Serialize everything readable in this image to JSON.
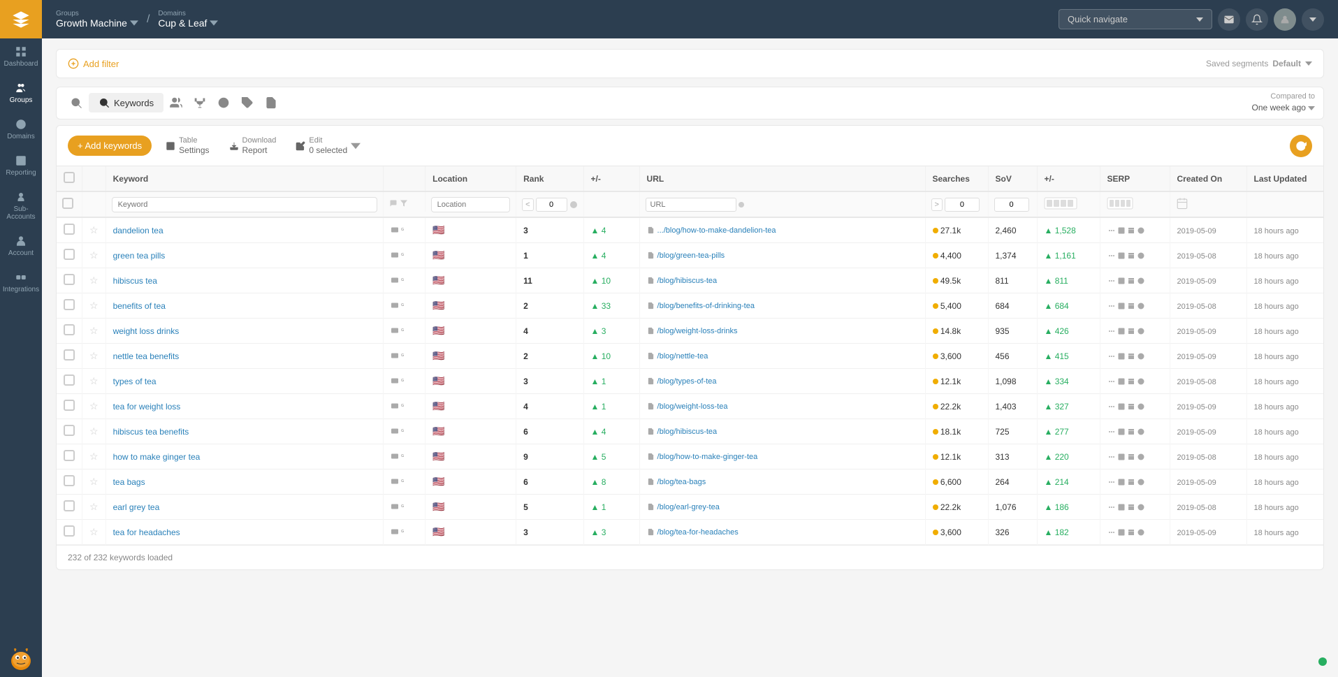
{
  "app": {
    "logo_alt": "App logo"
  },
  "sidebar": {
    "items": [
      {
        "id": "dashboard",
        "label": "Dashboard",
        "icon": "dashboard"
      },
      {
        "id": "groups",
        "label": "Groups",
        "icon": "groups",
        "active": true
      },
      {
        "id": "domains",
        "label": "Domains",
        "icon": "domains"
      },
      {
        "id": "reporting",
        "label": "Reporting",
        "icon": "reporting"
      },
      {
        "id": "sub-accounts",
        "label": "Sub-Accounts",
        "icon": "sub-accounts"
      },
      {
        "id": "account",
        "label": "Account",
        "icon": "account"
      },
      {
        "id": "integrations",
        "label": "Integrations",
        "icon": "integrations"
      }
    ]
  },
  "topbar": {
    "breadcrumb": {
      "groups_label": "Groups",
      "groups_value": "Growth Machine",
      "domains_label": "Domains",
      "domains_value": "Cup & Leaf"
    },
    "quick_navigate_placeholder": "Quick navigate",
    "compared_to_label": "Compared to",
    "compared_to_value": "One week ago"
  },
  "filter_bar": {
    "add_filter_label": "Add filter",
    "saved_segments_label": "Saved segments",
    "saved_segments_value": "Default"
  },
  "toolbar": {
    "tabs": [
      {
        "id": "scan",
        "icon": "scan",
        "active": false,
        "label": ""
      },
      {
        "id": "keywords",
        "icon": "keyword",
        "active": true,
        "label": "Keywords"
      },
      {
        "id": "competitors",
        "icon": "competitors",
        "active": false,
        "label": ""
      },
      {
        "id": "trophy",
        "icon": "trophy",
        "active": false,
        "label": ""
      },
      {
        "id": "target",
        "icon": "target",
        "active": false,
        "label": ""
      },
      {
        "id": "tags",
        "icon": "tags",
        "active": false,
        "label": ""
      },
      {
        "id": "notes",
        "icon": "notes",
        "active": false,
        "label": ""
      }
    ]
  },
  "action_bar": {
    "add_keywords_label": "+ Add keywords",
    "table_settings_label": "Table\nSettings",
    "download_report_label": "Download\nReport",
    "edit_label": "Edit",
    "selected_count": "0 selected"
  },
  "table": {
    "headers": [
      "Keyword",
      "Location",
      "Rank",
      "+/-",
      "URL",
      "Searches",
      "SoV",
      "+/-",
      "SERP",
      "Created On",
      "Last Updated"
    ],
    "rows": [
      {
        "keyword": "dandelion tea",
        "flag": "🇺🇸",
        "rank": "3",
        "delta": "+4",
        "delta_type": "pos",
        "url": ".../blog/how-to-make-dandelion-tea",
        "searches": "27.1k",
        "sov": "2,460",
        "sov_delta": "+1,528",
        "sov_delta_type": "pos",
        "date_created": "2019-05-09",
        "last_updated": "18 hours ago"
      },
      {
        "keyword": "green tea pills",
        "flag": "🇺🇸",
        "rank": "1",
        "delta": "+4",
        "delta_type": "pos",
        "url": "/blog/green-tea-pills",
        "searches": "4,400",
        "sov": "1,374",
        "sov_delta": "+1,161",
        "sov_delta_type": "pos",
        "date_created": "2019-05-08",
        "last_updated": "18 hours ago"
      },
      {
        "keyword": "hibiscus tea",
        "flag": "🇺🇸",
        "rank": "11",
        "delta": "+10",
        "delta_type": "pos",
        "url": "/blog/hibiscus-tea",
        "searches": "49.5k",
        "sov": "811",
        "sov_delta": "+811",
        "sov_delta_type": "pos",
        "date_created": "2019-05-09",
        "last_updated": "18 hours ago"
      },
      {
        "keyword": "benefits of tea",
        "flag": "🇺🇸",
        "rank": "2",
        "delta": "+33",
        "delta_type": "pos",
        "url": "/blog/benefits-of-drinking-tea",
        "searches": "5,400",
        "sov": "684",
        "sov_delta": "+684",
        "sov_delta_type": "pos",
        "date_created": "2019-05-08",
        "last_updated": "18 hours ago"
      },
      {
        "keyword": "weight loss drinks",
        "flag": "🇺🇸",
        "rank": "4",
        "delta": "+3",
        "delta_type": "pos",
        "url": "/blog/weight-loss-drinks",
        "searches": "14.8k",
        "sov": "935",
        "sov_delta": "+426",
        "sov_delta_type": "pos",
        "date_created": "2019-05-09",
        "last_updated": "18 hours ago"
      },
      {
        "keyword": "nettle tea benefits",
        "flag": "🇺🇸",
        "rank": "2",
        "delta": "+10",
        "delta_type": "pos",
        "url": "/blog/nettle-tea",
        "searches": "3,600",
        "sov": "456",
        "sov_delta": "+415",
        "sov_delta_type": "pos",
        "date_created": "2019-05-09",
        "last_updated": "18 hours ago"
      },
      {
        "keyword": "types of tea",
        "flag": "🇺🇸",
        "rank": "3",
        "delta": "+1",
        "delta_type": "pos",
        "url": "/blog/types-of-tea",
        "searches": "12.1k",
        "sov": "1,098",
        "sov_delta": "+334",
        "sov_delta_type": "pos",
        "date_created": "2019-05-08",
        "last_updated": "18 hours ago"
      },
      {
        "keyword": "tea for weight loss",
        "flag": "🇺🇸",
        "rank": "4",
        "delta": "+1",
        "delta_type": "pos",
        "url": "/blog/weight-loss-tea",
        "searches": "22.2k",
        "sov": "1,403",
        "sov_delta": "+327",
        "sov_delta_type": "pos",
        "date_created": "2019-05-09",
        "last_updated": "18 hours ago"
      },
      {
        "keyword": "hibiscus tea benefits",
        "flag": "🇺🇸",
        "rank": "6",
        "delta": "+4",
        "delta_type": "pos",
        "url": "/blog/hibiscus-tea",
        "searches": "18.1k",
        "sov": "725",
        "sov_delta": "+277",
        "sov_delta_type": "pos",
        "date_created": "2019-05-09",
        "last_updated": "18 hours ago"
      },
      {
        "keyword": "how to make ginger tea",
        "flag": "🇺🇸",
        "rank": "9",
        "delta": "+5",
        "delta_type": "pos",
        "url": "/blog/how-to-make-ginger-tea",
        "searches": "12.1k",
        "sov": "313",
        "sov_delta": "+220",
        "sov_delta_type": "pos",
        "date_created": "2019-05-08",
        "last_updated": "18 hours ago"
      },
      {
        "keyword": "tea bags",
        "flag": "🇺🇸",
        "rank": "6",
        "delta": "+8",
        "delta_type": "pos",
        "url": "/blog/tea-bags",
        "searches": "6,600",
        "sov": "264",
        "sov_delta": "+214",
        "sov_delta_type": "pos",
        "date_created": "2019-05-09",
        "last_updated": "18 hours ago"
      },
      {
        "keyword": "earl grey tea",
        "flag": "🇺🇸",
        "rank": "5",
        "delta": "+1",
        "delta_type": "pos",
        "url": "/blog/earl-grey-tea",
        "searches": "22.2k",
        "sov": "1,076",
        "sov_delta": "+186",
        "sov_delta_type": "pos",
        "date_created": "2019-05-08",
        "last_updated": "18 hours ago"
      },
      {
        "keyword": "tea for headaches",
        "flag": "🇺🇸",
        "rank": "3",
        "delta": "+3",
        "delta_type": "pos",
        "url": "/blog/tea-for-headaches",
        "searches": "3,600",
        "sov": "326",
        "sov_delta": "+182",
        "sov_delta_type": "pos",
        "date_created": "2019-05-09",
        "last_updated": "18 hours ago"
      }
    ],
    "footer": "232 of 232 keywords loaded"
  }
}
